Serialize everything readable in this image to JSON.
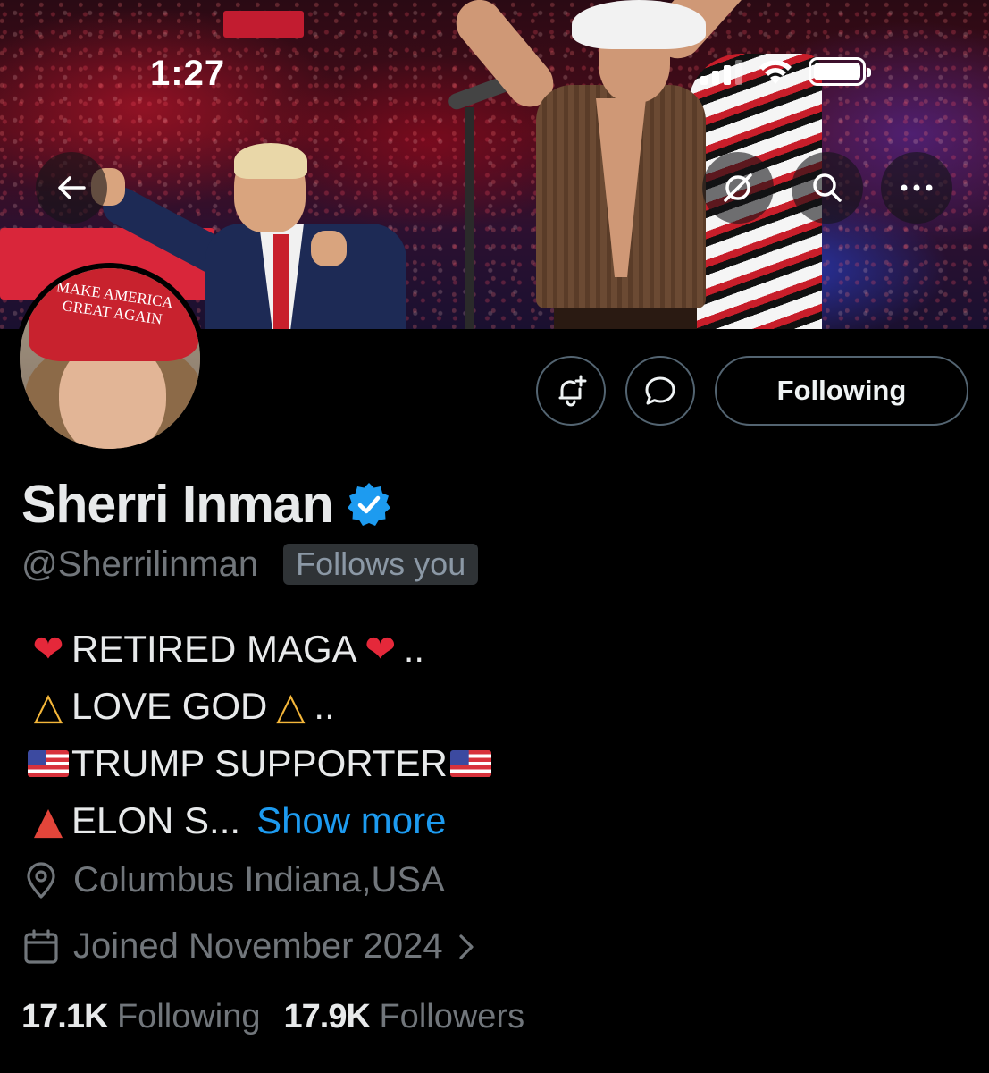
{
  "status_bar": {
    "time": "1:27"
  },
  "header_buttons": {
    "back_icon": "arrow-left-icon",
    "grok_icon": "slash-circle-icon",
    "search_icon": "search-icon",
    "more_icon": "more-horizontal-icon"
  },
  "avatar": {
    "hat_text": "MAKE AMERICA GREAT AGAIN"
  },
  "actions": {
    "notify_icon": "bell-plus-icon",
    "message_icon": "message-bubble-icon",
    "following_label": "Following"
  },
  "profile": {
    "display_name": "Sherri Inman",
    "verified_color": "#1d9bf0",
    "handle": "@Sherrilinman",
    "follows_you": "Follows you",
    "bio": {
      "line1": "RETIRED MAGA",
      "line1_suffix": "..",
      "line2": "LOVE GOD",
      "line2_suffix": "..",
      "line3": "TRUMP SUPPORTER",
      "line4": "ELON S...",
      "show_more": "Show more"
    },
    "location": "Columbus Indiana,USA",
    "joined": "Joined November 2024"
  },
  "stats": {
    "following_count": "17.1K",
    "following_label": "Following",
    "followers_count": "17.9K",
    "followers_label": "Followers"
  },
  "colors": {
    "accent": "#1d9bf0",
    "muted": "#71767b",
    "background": "#000000"
  }
}
